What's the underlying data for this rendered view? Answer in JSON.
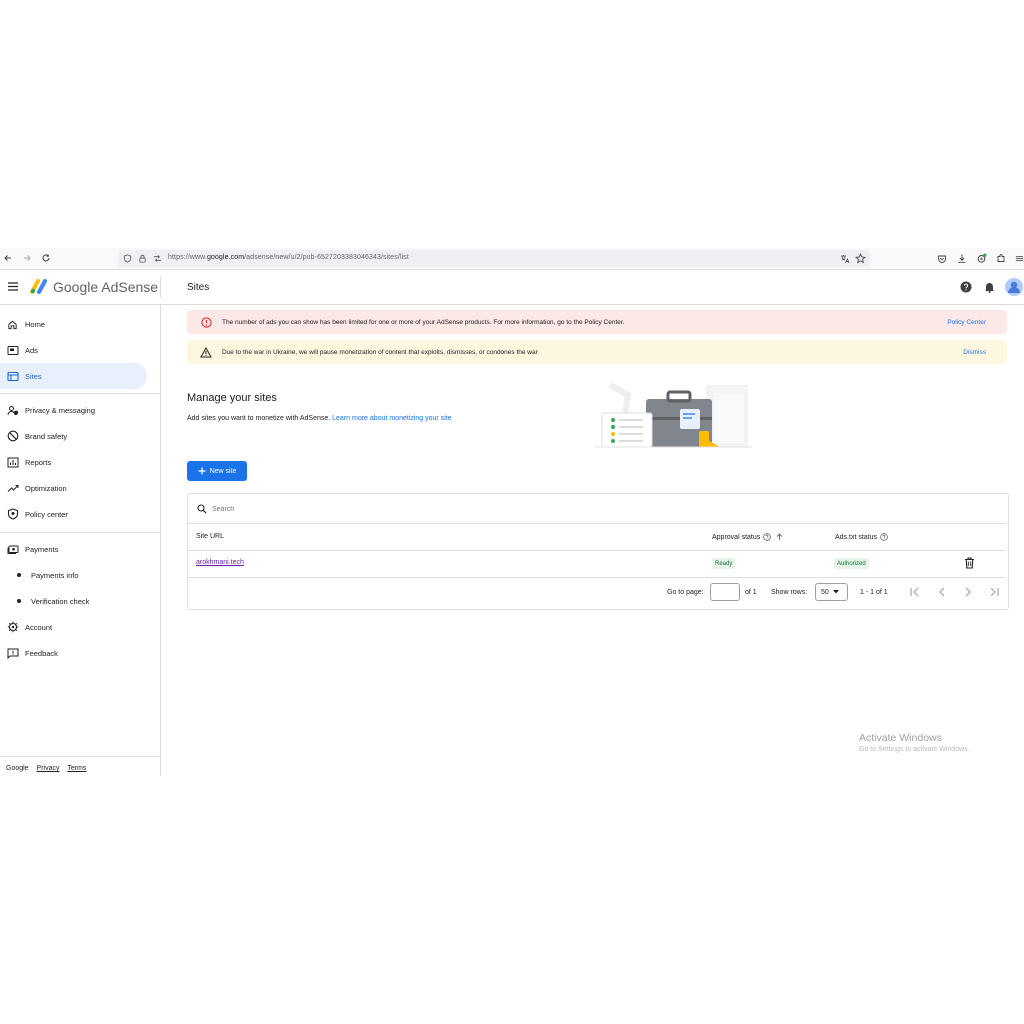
{
  "browser": {
    "url_prefix": "https://www.",
    "url_domain": "google.com",
    "url_path": "/adsense/new/u/2/pub-6527203383046343/sites/list"
  },
  "header": {
    "brand": "Google AdSense",
    "page_title": "Sites"
  },
  "sidebar": {
    "items": [
      {
        "label": "Home",
        "icon": "home-icon"
      },
      {
        "label": "Ads",
        "icon": "ads-icon"
      },
      {
        "label": "Sites",
        "icon": "sites-icon",
        "active": true
      },
      {
        "label": "Privacy & messaging",
        "icon": "privacy-icon"
      },
      {
        "label": "Brand safety",
        "icon": "brand-safety-icon"
      },
      {
        "label": "Reports",
        "icon": "reports-icon"
      },
      {
        "label": "Optimization",
        "icon": "optimization-icon"
      },
      {
        "label": "Policy center",
        "icon": "policy-center-icon"
      },
      {
        "label": "Payments",
        "icon": "payments-icon"
      },
      {
        "label": "Payments info"
      },
      {
        "label": "Verification check"
      },
      {
        "label": "Account",
        "icon": "account-gear-icon"
      },
      {
        "label": "Feedback",
        "icon": "feedback-icon"
      }
    ],
    "footer": {
      "brand": "Google",
      "privacy": "Privacy",
      "terms": "Terms"
    }
  },
  "banners": {
    "policy": {
      "message": "The number of ads you can show has been limited for one or more of your AdSense products. For more information, go to the Policy Center.",
      "action": "Policy Center",
      "color": "#fce8e6"
    },
    "ukraine": {
      "message": "Due to the war in Ukraine, we will pause monetization of content that exploits, dismisses, or condones the war",
      "action": "Dismiss",
      "color": "#fef7e0"
    }
  },
  "manage": {
    "title": "Manage your sites",
    "description": "Add sites you want to monetize with AdSense. ",
    "link": "Learn more about monetizing your site",
    "new_site_label": "New site"
  },
  "table": {
    "search_placeholder": "Search",
    "columns": {
      "url": "Site URL",
      "approval": "Approval status",
      "adstxt": "Ads.txt status"
    },
    "rows": [
      {
        "url": "arokhmani.tech",
        "approval": "Ready",
        "adstxt": "Authorized"
      }
    ]
  },
  "pagination": {
    "goto_label": "Go to page:",
    "of_pages": "of 1",
    "show_rows_label": "Show rows:",
    "rows_value": "50",
    "range": "1 - 1 of 1"
  },
  "watermark": {
    "title": "Activate Windows",
    "subtitle": "Go to Settings to activate Windows."
  },
  "colors": {
    "accent": "#1a73e8",
    "active_nav_bg": "#e8f0fe",
    "error": "#d93025",
    "success_bg": "#e6f4ea"
  }
}
